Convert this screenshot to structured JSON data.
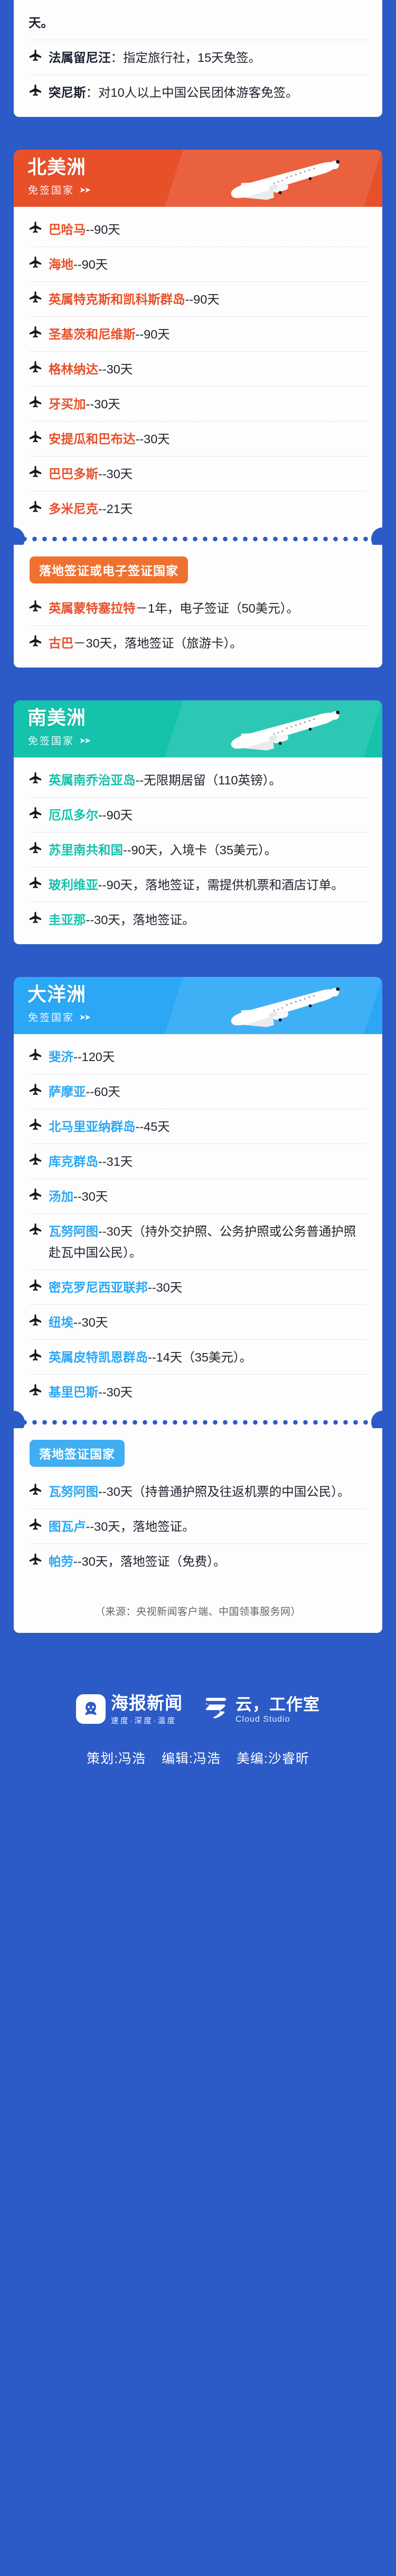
{
  "theme": {
    "page_bg": "#2C5BC8",
    "card_bg": "#FDFDFD",
    "north_america_color": "#E8502A",
    "south_america_color": "#15C2AC",
    "oceania_color": "#2BA8F5",
    "africa_color": "#C8934B",
    "body_text": "#1B2030"
  },
  "top_card": {
    "continuation_line": "天。",
    "items": [
      {
        "icon": "airplane-icon",
        "country": "法属留尼汪",
        "rest": "：指定旅行社，15天免签。"
      },
      {
        "icon": "airplane-icon",
        "country": "突尼斯",
        "rest": "：对10人以上中国公民团体游客免签。"
      }
    ]
  },
  "sections": [
    {
      "id": "north-america",
      "title": "北美洲",
      "subtitle": "免签国家",
      "banner_color": "#E8502A",
      "accent": "#E8502A",
      "visa_free": [
        {
          "country": "巴哈马",
          "rest": "--90天"
        },
        {
          "country": "海地",
          "rest": "--90天"
        },
        {
          "country": "英属特克斯和凯科斯群岛",
          "rest": "--90天"
        },
        {
          "country": "圣基茨和尼维斯",
          "rest": "--90天"
        },
        {
          "country": "格林纳达",
          "rest": "--30天"
        },
        {
          "country": "牙买加",
          "rest": "--30天"
        },
        {
          "country": "安提瓜和巴布达",
          "rest": "--30天"
        },
        {
          "country": "巴巴多斯",
          "rest": "--30天"
        },
        {
          "country": "多米尼克",
          "rest": "--21天"
        }
      ],
      "pill_label": "落地签证或电子签证国家",
      "pill_color": "#F0712F",
      "on_arrival": [
        {
          "country": "英属蒙特塞拉特",
          "rest": "－1年，电子签证（50美元）。"
        },
        {
          "country": "古巴",
          "rest": "－30天，落地签证（旅游卡）。"
        }
      ]
    },
    {
      "id": "south-america",
      "title": "南美洲",
      "subtitle": "免签国家",
      "banner_color": "#15C2AC",
      "accent": "#15C2AC",
      "visa_free": [
        {
          "country": "英属南乔治亚岛",
          "rest": "--无限期居留（110英镑）。"
        },
        {
          "country": "厄瓜多尔",
          "rest": "--90天"
        },
        {
          "country": "苏里南共和国",
          "rest": "--90天，入境卡（35美元）。"
        },
        {
          "country": "玻利维亚",
          "rest": "--90天，落地签证，需提供机票和酒店订单。"
        },
        {
          "country": "圭亚那",
          "rest": "--30天，落地签证。"
        }
      ],
      "pill_label": null,
      "pill_color": null,
      "on_arrival": []
    },
    {
      "id": "oceania",
      "title": "大洋洲",
      "subtitle": "免签国家",
      "banner_color": "#2BA8F5",
      "accent": "#2BA8F5",
      "visa_free": [
        {
          "country": "斐济",
          "rest": "--120天"
        },
        {
          "country": "萨摩亚",
          "rest": "--60天"
        },
        {
          "country": "北马里亚纳群岛",
          "rest": "--45天"
        },
        {
          "country": "库克群岛",
          "rest": "--31天"
        },
        {
          "country": "汤加",
          "rest": "--30天"
        },
        {
          "country": "瓦努阿图",
          "rest": "--30天（持外交护照、公务护照或公务普通护照赴瓦中国公民）。"
        },
        {
          "country": "密克罗尼西亚联邦",
          "rest": "--30天"
        },
        {
          "country": "纽埃",
          "rest": "--30天"
        },
        {
          "country": "英属皮特凯恩群岛",
          "rest": "--14天（35美元）。"
        },
        {
          "country": "基里巴斯",
          "rest": "--30天"
        }
      ],
      "pill_label": "落地签证国家",
      "pill_color": "#3FAEF2",
      "on_arrival": [
        {
          "country": "瓦努阿图",
          "rest": "--30天（持普通护照及往返机票的中国公民）。"
        },
        {
          "country": "图瓦卢",
          "rest": "--30天，落地签证。"
        },
        {
          "country": "帕劳",
          "rest": "--30天，落地签证（免费）。"
        }
      ]
    }
  ],
  "source_note": "（来源：央视新闻客户端、中国领事服务网）",
  "footer": {
    "brand_primary": {
      "icon": "seal-mascot-icon",
      "title": "海报新闻",
      "subtitle": "速度·深度·温度"
    },
    "brand_secondary": {
      "icon": "cloud-icon",
      "title": "云，工作室",
      "subtitle": "Cloud Studio"
    },
    "credits": [
      "策划:冯浩",
      "编辑:冯浩",
      "美编:沙睿昕"
    ]
  }
}
